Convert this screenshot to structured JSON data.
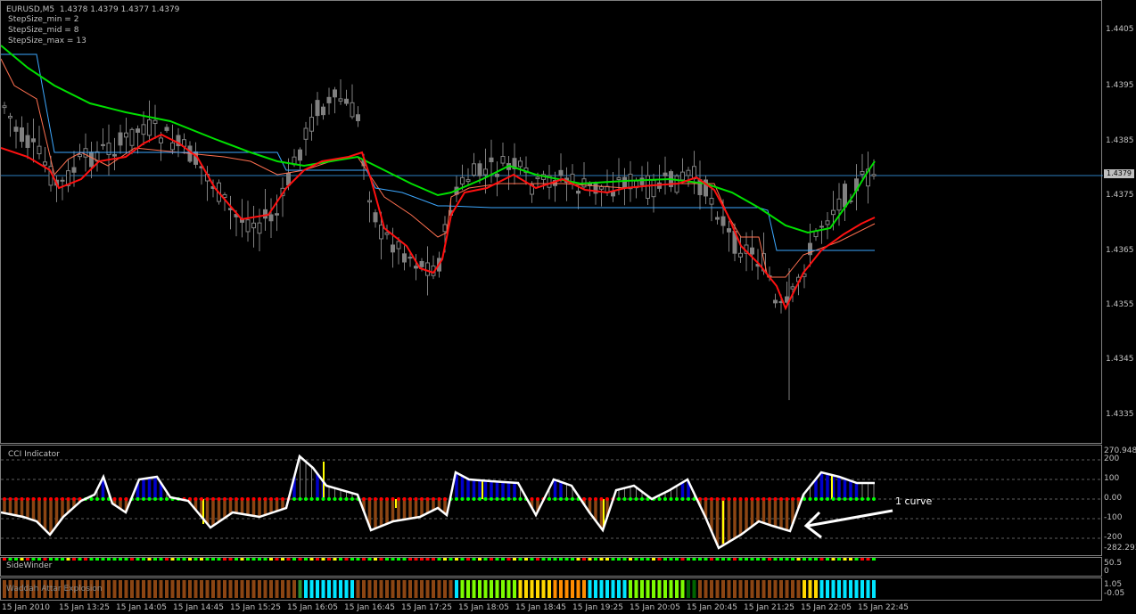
{
  "chart_header": {
    "symbol": "EURUSD,M5",
    "ohlc": "1.4378 1.4379 1.4377 1.4379",
    "params": [
      "StepSize_min = 2",
      "StepSize_mid = 8",
      "StepSize_max = 13"
    ]
  },
  "price_axis": {
    "ticks": [
      "1.4405",
      "1.4395",
      "1.4385",
      "1.4375",
      "1.4365",
      "1.4355",
      "1.4345",
      "1.4335"
    ],
    "current_price": "1.4379"
  },
  "cci_panel": {
    "title": "CCI Indicator",
    "axis": [
      "270.9488",
      "200",
      "100",
      "0.00",
      "-100",
      "-200",
      "-282.2936"
    ],
    "annotation": "1 curve"
  },
  "sidewinder_panel": {
    "title": "SideWinder",
    "axis": [
      "50.5",
      "0"
    ]
  },
  "bottom_panel": {
    "text": "Waddah Attar Explosion",
    "axis": [
      "1.05",
      "-0.05"
    ]
  },
  "time_axis": [
    "15 Jan 2010",
    "15 Jan 13:25",
    "15 Jan 14:05",
    "15 Jan 14:45",
    "15 Jan 15:25",
    "15 Jan 16:05",
    "15 Jan 16:45",
    "15 Jan 17:25",
    "15 Jan 18:05",
    "15 Jan 18:45",
    "15 Jan 19:25",
    "15 Jan 20:05",
    "15 Jan 20:45",
    "15 Jan 21:25",
    "15 Jan 22:05",
    "15 Jan 22:45"
  ],
  "colors": {
    "candle": "#808080",
    "green_line": "#00e000",
    "red_line": "#ff1010",
    "blue_line": "#3da8ff",
    "salmon_line": "#ff7050",
    "cci": "#ffffff",
    "bear_hist": "#8b4513",
    "bull_hist": "#0000cc",
    "signal": "#ffff00",
    "sw_green": "#00ff00",
    "sw_red": "#ff0000",
    "sw_yellow": "#ffff00",
    "cyan": "#00e5ff"
  }
}
